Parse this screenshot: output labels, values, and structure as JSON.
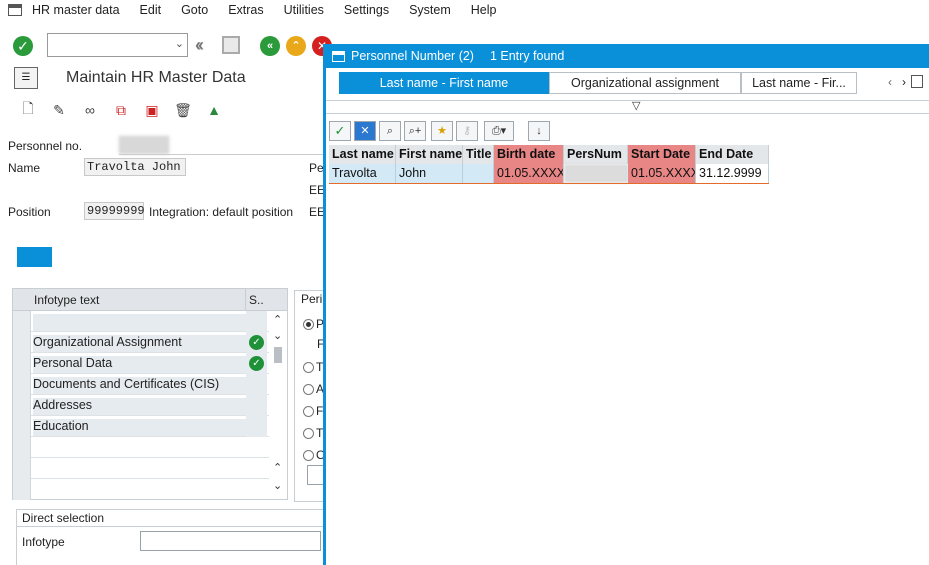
{
  "menubar": {
    "items": [
      "HR master data",
      "Edit",
      "Goto",
      "Extras",
      "Utilities",
      "Settings",
      "System",
      "Help"
    ]
  },
  "toolbar": {
    "command_field_value": ""
  },
  "screen": {
    "title": "Maintain HR Master Data",
    "personnel_no_label": "Personnel no.",
    "personnel_no_value": "",
    "name_label": "Name",
    "name_value": "Travolta John",
    "position_label": "Position",
    "position_value": "99999999",
    "position_text": "Integration: default position",
    "right_labels": [
      "Pe",
      "EE",
      "EE"
    ]
  },
  "infotypes": {
    "header_text": "Infotype text",
    "header_status": "S..",
    "rows": [
      {
        "text": "",
        "status": false
      },
      {
        "text": "Organizational Assignment",
        "status": true
      },
      {
        "text": "Personal Data",
        "status": true
      },
      {
        "text": "Documents and Certificates (CIS)",
        "status": false
      },
      {
        "text": "Addresses",
        "status": false
      },
      {
        "text": "Education",
        "status": false
      },
      {
        "text": "",
        "status": false
      },
      {
        "text": "",
        "status": false
      },
      {
        "text": "",
        "status": false
      }
    ]
  },
  "period": {
    "title": "Peri",
    "options": [
      "P",
      "F",
      "T",
      "A",
      "F",
      "T",
      "O"
    ]
  },
  "direct_selection": {
    "title": "Direct selection",
    "infotype_label": "Infotype",
    "infotype_value": ""
  },
  "popup": {
    "title": "Personnel Number (2)",
    "entries_found": "1 Entry found",
    "tabs": [
      "Last name - First name",
      "Organizational assignment",
      "Last name - Fir..."
    ],
    "columns": [
      "Last name",
      "First name",
      "Title",
      "Birth date",
      "PersNum",
      "Start Date",
      "End Date"
    ],
    "row": {
      "last_name": "Travolta",
      "first_name": "John",
      "title": "",
      "birth_date": "01.05.XXXX",
      "pers_num": "",
      "start_date": "01.05.XXXX",
      "end_date": "31.12.9999"
    }
  },
  "colors": {
    "accent": "#0a8fd9",
    "highlight": "#e88585",
    "row_selected": "#d3e9f6",
    "ok_green": "#1f9138"
  }
}
